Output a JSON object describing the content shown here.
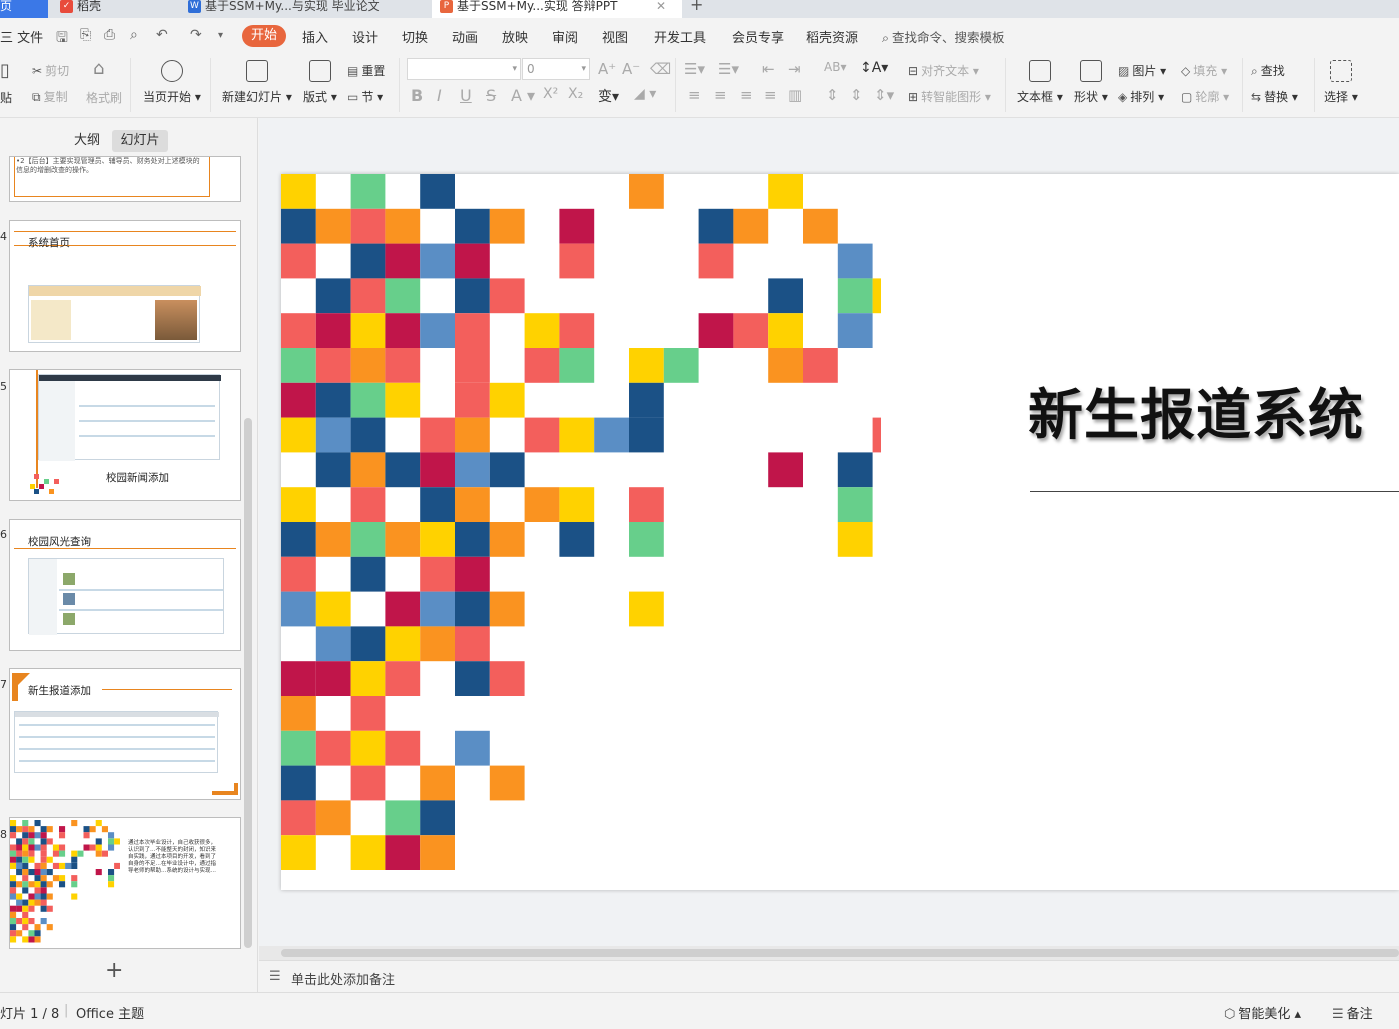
{
  "tabs": {
    "home": "页",
    "wps": "稻壳",
    "doc": "基于SSM+My...与实现 毕业论文",
    "ppt": "基于SSM+My...实现 答辩PPT",
    "add": "+"
  },
  "menu": {
    "file": "三 文件",
    "start": "开始",
    "insert": "插入",
    "design": "设计",
    "transition": "切换",
    "animation": "动画",
    "slideshow": "放映",
    "review": "审阅",
    "view": "视图",
    "devtools": "开发工具",
    "member": "会员专享",
    "docer": "稻壳资源",
    "search": "查找命令、搜索模板"
  },
  "ribbon": {
    "paste": "贴",
    "cut": "剪切",
    "copy": "复制",
    "format_painter": "格式刷",
    "play_current": "当页开始",
    "new_slide": "新建幻灯片",
    "layout": "版式",
    "reset": "重置",
    "section": "节",
    "font_size": "0",
    "align_text": "对齐文本",
    "smartart": "转智能图形",
    "textbox": "文本框",
    "shape": "形状",
    "picture": "图片",
    "arrange": "排列",
    "fill": "填充",
    "outline": "轮廓",
    "find": "查找",
    "replace": "替换",
    "select": "选择"
  },
  "left_panel": {
    "tab_outline": "大纲",
    "tab_slides": "幻灯片",
    "slides": [
      {
        "num": "",
        "title": "•2【后台】主要实现管理员、辅导员、财务处对上述模块的信息的增删改查的操作。"
      },
      {
        "num": "4",
        "title": "系统首页"
      },
      {
        "num": "5",
        "title": "校园新闻添加"
      },
      {
        "num": "6",
        "title": "校园风光查询"
      },
      {
        "num": "7",
        "title": "新生报道添加"
      },
      {
        "num": "8",
        "title": "通过本次毕业设计，自己收获很多，认识到了…不能整天的封闭，知识来自实践，通过本项目的开发，看到了自身的不足…在毕业设计中，通过指导老师的帮助…系统的设计与实现…"
      }
    ],
    "add": "+"
  },
  "slide": {
    "title": "新生报道系统"
  },
  "notes": {
    "placeholder": "单击此处添加备注"
  },
  "status": {
    "slide_index": "灯片 1 / 8",
    "theme": "Office 主题",
    "beautify": "智能美化",
    "notes_btn": "备注"
  },
  "colors": {
    "accent": "#e8663d",
    "mosaic": [
      "#ffd200",
      "#1b5186",
      "#fa9320",
      "#f35f5c",
      "#c0154a",
      "#5a8ec5",
      "#67cf8b"
    ]
  }
}
